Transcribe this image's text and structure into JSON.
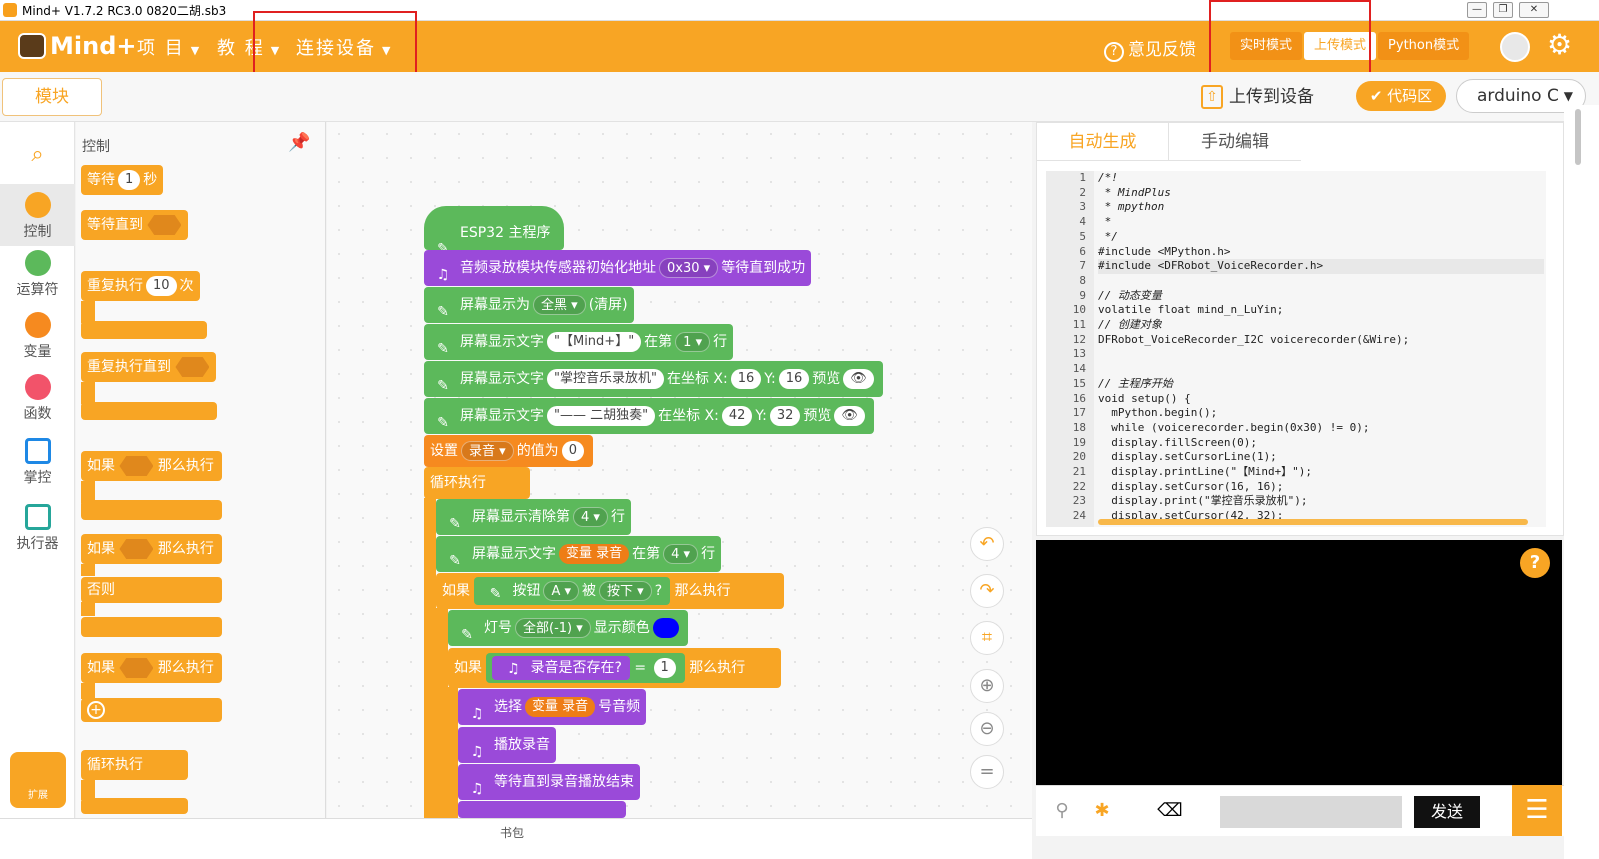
{
  "window": {
    "title": "Mind+ V1.7.2 RC3.0   0820二胡.sb3",
    "buttons": [
      "—",
      "❐",
      "✕"
    ]
  },
  "topbar": {
    "logo": "Mind+",
    "menus": [
      {
        "label": "项 目"
      },
      {
        "label": "教 程"
      },
      {
        "label": "连接设备"
      }
    ],
    "feedback": "意见反馈",
    "modes": [
      "实时模式",
      "上传模式",
      "Python模式"
    ],
    "active_mode": "上传模式"
  },
  "subbar": {
    "modules_tab": "模块",
    "upload_button": "上传到设备",
    "code_region": "代码区",
    "board_select": "arduino C"
  },
  "categories": [
    {
      "label": "",
      "icon": "search-icon"
    },
    {
      "label": "控制",
      "color": "#f8a524"
    },
    {
      "label": "运算符",
      "color": "#5cb95b"
    },
    {
      "label": "变量",
      "color": "#f68a1f"
    },
    {
      "label": "函数",
      "color": "#f2536a"
    },
    {
      "label": "掌控",
      "icon": "chip-icon"
    },
    {
      "label": "执行器",
      "icon": "actuator-icon"
    }
  ],
  "extension_label": "扩展",
  "flyout": {
    "title": "控制",
    "wait": {
      "a": "等待",
      "value": "1",
      "b": "秒"
    },
    "wait_until": "等待直到",
    "repeat": {
      "a": "重复执行",
      "value": "10",
      "b": "次"
    },
    "repeat_until": "重复执行直到",
    "if_then": {
      "a": "如果",
      "b": "那么执行"
    },
    "if_else": {
      "a": "如果",
      "b": "那么执行",
      "c": "否则"
    },
    "if_then2": {
      "a": "如果",
      "b": "那么执行"
    },
    "forever": "循环执行"
  },
  "script": {
    "hat": "ESP32 主程序",
    "b1": {
      "text": "音频录放模块传感器初始化地址",
      "addr": "0x30",
      "tail": "等待直到成功"
    },
    "b2": {
      "text": "屏幕显示为",
      "opt": "全黑",
      "tail": "(清屏)"
    },
    "b3": {
      "text": "屏幕显示文字",
      "str": "\"【Mind+】\"",
      "mid": "在第",
      "line": "1",
      "tail": "行"
    },
    "b4": {
      "text": "屏幕显示文字",
      "str": "\"掌控音乐录放机\"",
      "mid": "在坐标 X:",
      "x": "16",
      "ylab": "Y:",
      "y": "16",
      "tail": "预览"
    },
    "b5": {
      "text": "屏幕显示文字",
      "str": "\"—— 二胡独奏\"",
      "mid": "在坐标 X:",
      "x": "42",
      "ylab": "Y:",
      "y": "32",
      "tail": "预览"
    },
    "b6": {
      "a": "设置",
      "var": "录音",
      "b": "的值为",
      "value": "0"
    },
    "loop": "循环执行",
    "b7": {
      "text": "屏幕显示清除第",
      "line": "4",
      "tail": "行"
    },
    "b8": {
      "text": "屏幕显示文字",
      "var": "变量 录音",
      "mid": "在第",
      "line": "4",
      "tail": "行"
    },
    "if1": {
      "a": "如果",
      "btn": "按钮",
      "key": "A",
      "pressed": "被",
      "state": "按下",
      "q": "?",
      "b": "那么执行"
    },
    "led": {
      "text": "灯号",
      "opt": "全部(-1)",
      "tail": "显示颜色"
    },
    "if2": {
      "a": "如果",
      "cond": "录音是否存在?",
      "eq": "=",
      "value": "1",
      "b": "那么执行"
    },
    "sel": {
      "text": "选择",
      "var": "变量 录音",
      "tail": "号音频"
    },
    "play": "播放录音",
    "waitplay": "等待直到录音播放结束"
  },
  "backpack": "书包",
  "code_tabs": [
    "自动生成",
    "手动编辑"
  ],
  "code": [
    "/*!",
    " * MindPlus",
    " * mpython",
    " *",
    " */",
    "#include <MPython.h>",
    "#include <DFRobot_VoiceRecorder.h>",
    "",
    "// 动态变量",
    "volatile float mind_n_LuYin;",
    "// 创建对象",
    "DFRobot_VoiceRecorder_I2C voicerecorder(&Wire);",
    "",
    "",
    "// 主程序开始",
    "void setup() {",
    "  mPython.begin();",
    "  while (voicerecorder.begin(0x30) != 0);",
    "  display.fillScreen(0);",
    "  display.setCursorLine(1);",
    "  display.printLine(\"【Mind+】\");",
    "  display.setCursor(16, 16);",
    "  display.print(\"掌控音乐录放机\");",
    "  display.setCursor(42, 32);"
  ],
  "line_numbers": [
    "1",
    "2",
    "3",
    "4",
    "5",
    "6",
    "7",
    "8",
    "9",
    "10",
    "11",
    "12",
    "13",
    "14",
    "15",
    "16",
    "17",
    "18",
    "19",
    "20",
    "21",
    "22",
    "23",
    "24"
  ],
  "serial": {
    "send": "发送",
    "input_value": ""
  },
  "colors": {
    "brand": "#f8a524",
    "control": "#f8a524",
    "purple": "#9a4ad9",
    "green": "#5cb95b",
    "led_color": "#0000ff"
  }
}
